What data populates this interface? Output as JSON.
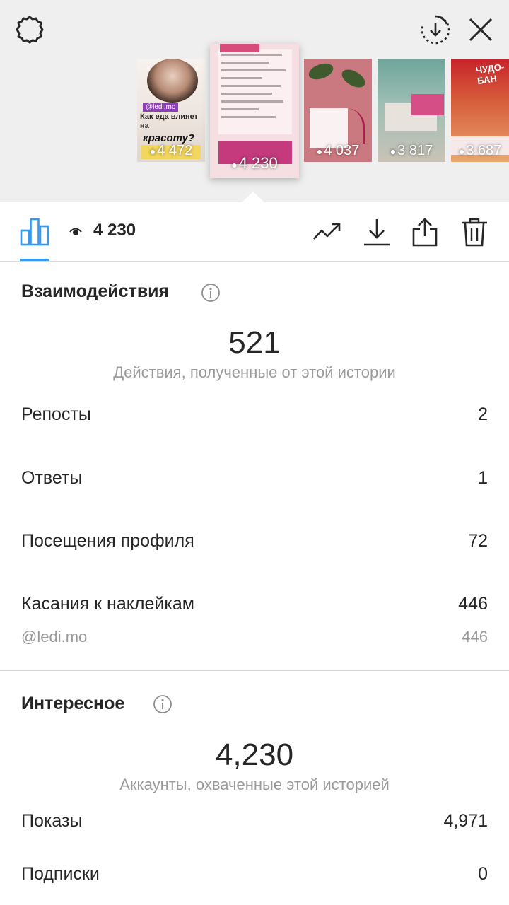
{
  "stories": [
    {
      "views": "4 472",
      "tag": "@ledi.mo",
      "headline": "Как еда влияет на",
      "big": "красоту?"
    },
    {
      "views": "4 230"
    },
    {
      "views": "4 037"
    },
    {
      "views": "3 817"
    },
    {
      "views": "3 687",
      "title": "ЧУДО-БАН"
    }
  ],
  "toolbar": {
    "view_count": "4 230"
  },
  "interactions": {
    "title": "Взаимодействия",
    "total": "521",
    "total_caption": "Действия, полученные от этой истории",
    "rows": [
      {
        "label": "Репосты",
        "value": "2"
      },
      {
        "label": "Ответы",
        "value": "1"
      },
      {
        "label": "Посещения профиля",
        "value": "72"
      },
      {
        "label": "Касания к наклейкам",
        "value": "446"
      }
    ],
    "sticker": {
      "label": "@ledi.mo",
      "value": "446"
    }
  },
  "discovery": {
    "title": "Интересное",
    "total": "4,230",
    "total_caption": "Аккаунты, охваченные этой историей",
    "rows": [
      {
        "label": "Показы",
        "value": "4,971"
      },
      {
        "label": "Подписки",
        "value": "0"
      }
    ]
  },
  "colors": {
    "accent": "#3897f0",
    "text": "#262626",
    "muted": "#9a9a9a",
    "strip_bg": "#efefef"
  }
}
